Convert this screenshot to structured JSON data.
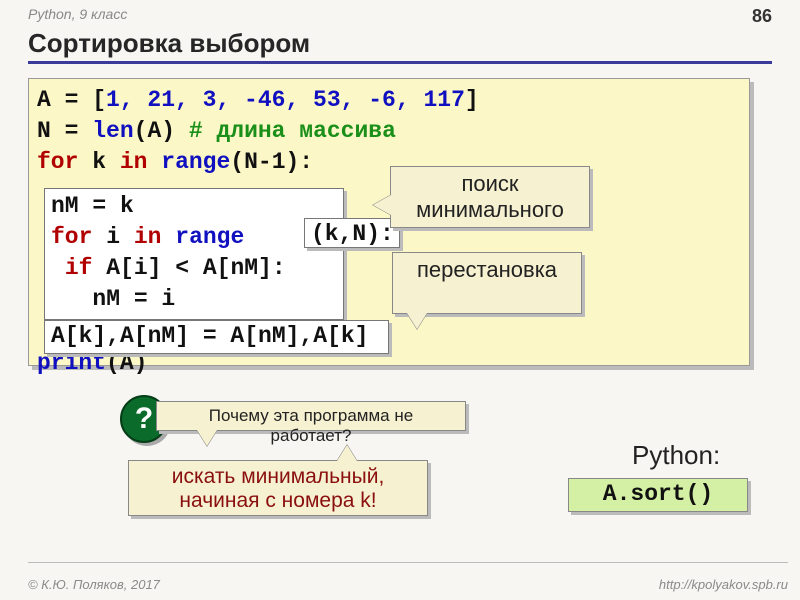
{
  "header": {
    "breadcrumb": "Python, 9 класс",
    "page": "86"
  },
  "title": "Сортировка выбором",
  "code": {
    "l1_a": "A = [",
    "l1_vals": "1, 21, 3, -46, 53, -6, 117",
    "l1_b": "]",
    "l2_a": "N = ",
    "l2_fn": "len",
    "l2_b": "(A) ",
    "l2_cmt": "# длина массива",
    "l3_a": "for",
    "l3_b": " k ",
    "l3_c": "in",
    "l3_d": " ",
    "l3_fn": "range",
    "l3_e": "(N-1):",
    "l_search_1": "nM = k",
    "l_search_2a": "for",
    "l_search_2b": " i ",
    "l_search_2c": "in",
    "l_search_2d": " ",
    "l_search_2fn": "range",
    "kn": "(k,N):",
    "l_search_3a": "if",
    "l_search_3b": " A[i] < A[nM]:",
    "l_search_4": "nM = i",
    "swap": "A[k],A[nM] = A[nM],A[k]",
    "l_print_a": "print",
    "l_print_b": "(A)"
  },
  "callouts": {
    "search": "поиск минимального",
    "swap": "перестановка",
    "question_mark": "?",
    "question": "Почему эта программа не работает?",
    "answer": "искать минимальный, начиная с номера k!"
  },
  "python": {
    "label": "Python:",
    "sort": "A.sort()"
  },
  "footer": {
    "left": "© К.Ю. Поляков, 2017",
    "right": "http://kpolyakov.spb.ru"
  }
}
